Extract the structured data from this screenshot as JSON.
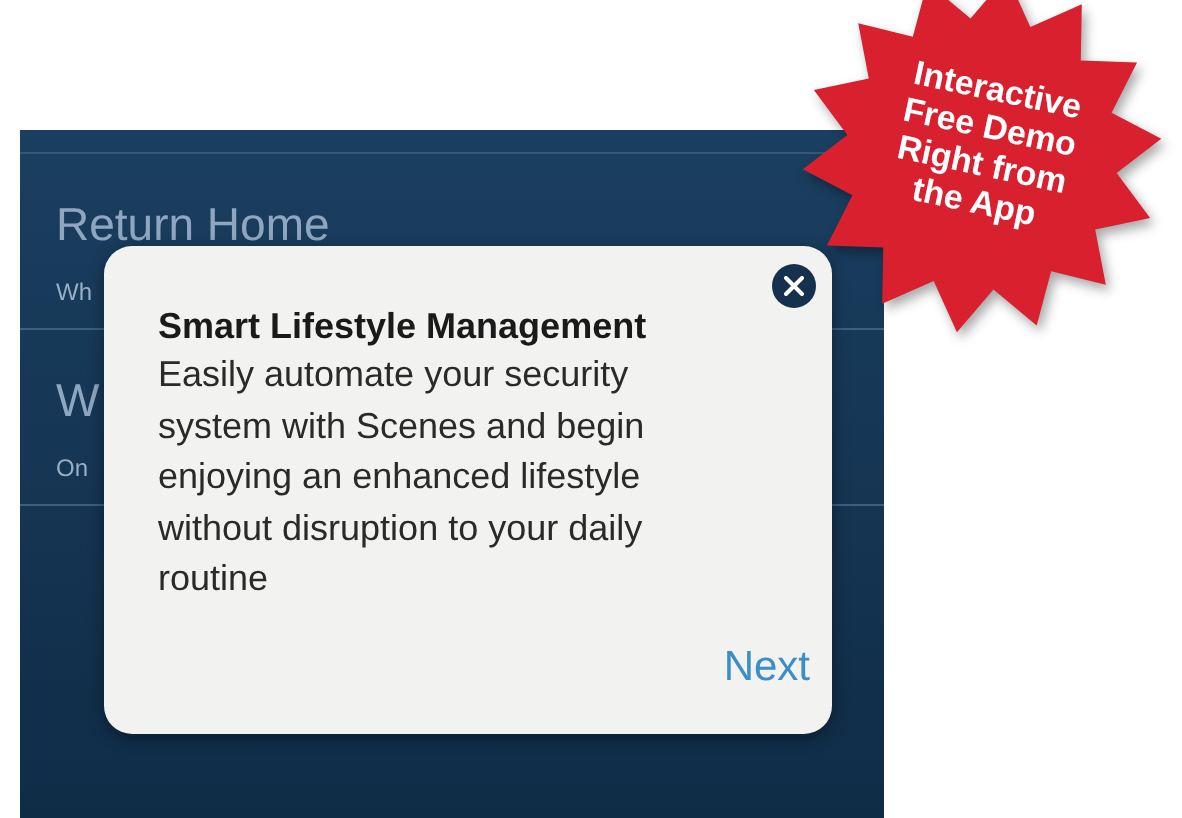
{
  "background_list": [
    {
      "title": "Return Home",
      "subtitle": "Wh"
    },
    {
      "title": "W",
      "subtitle": "On"
    }
  ],
  "popup": {
    "title": "Smart Lifestyle Management",
    "body": "Easily automate your security system with Scenes and begin enjoying an enhanced lifestyle without disruption to your daily routine",
    "action": "Next"
  },
  "badge": {
    "lines": [
      "Interactive",
      "Free Demo",
      "Right from",
      "the App"
    ]
  }
}
